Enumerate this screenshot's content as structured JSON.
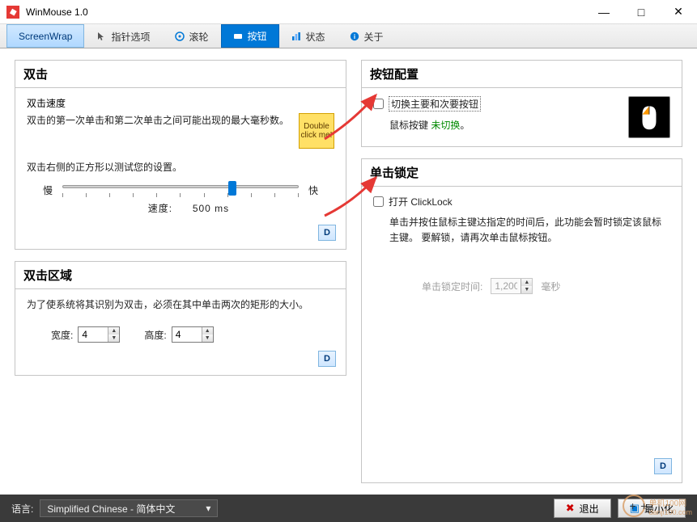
{
  "window": {
    "title": "WinMouse 1.0"
  },
  "tabs": {
    "screenwrap": "ScreenWrap",
    "pointer": "指针选项",
    "wheel": "滚轮",
    "buttons": "按钮",
    "state": "状态",
    "about": "关于"
  },
  "doubleclick": {
    "group_title": "双击",
    "speed_label": "双击速度",
    "speed_desc": "双击的第一次单击和第二次单击之间可能出现的最大毫秒数。",
    "test_box": "Double click me!",
    "test_hint": "双击右侧的正方形以测试您的设置。",
    "slow": "慢",
    "fast": "快",
    "speed_prefix": "速度:",
    "speed_value": "500 ms",
    "d_btn": "D"
  },
  "dcarea": {
    "group_title": "双击区域",
    "desc": "为了使系统将其识别为双击，必须在其中单击两次的矩形的大小。",
    "width_label": "宽度:",
    "width_value": "4",
    "height_label": "高度:",
    "height_value": "4",
    "d_btn": "D"
  },
  "btncfg": {
    "group_title": "按钮配置",
    "swap_label": "切换主要和次要按钮",
    "sub_prefix": "鼠标按键 ",
    "sub_status": "未切换",
    "sub_suffix": "。"
  },
  "clicklock": {
    "group_title": "单击锁定",
    "open_label": "打开 ClickLock",
    "desc": "单击并按住鼠标主键达指定的时间后，此功能会暂时锁定该鼠标主键。 要解锁，请再次单击鼠标按钮。",
    "time_label": "单击锁定时间:",
    "time_value": "1,200",
    "time_unit": "毫秒",
    "d_btn": "D"
  },
  "bottom": {
    "lang_label": "语言:",
    "lang_value": "Simplified Chinese  -  简体中文",
    "exit": "退出",
    "minimize": "最小化"
  },
  "watermark": {
    "text": "单机100网",
    "url": "danji100.com"
  }
}
